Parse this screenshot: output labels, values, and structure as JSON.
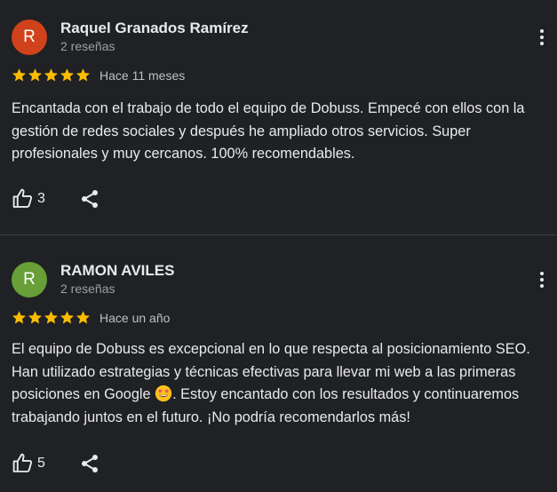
{
  "colors": {
    "background": "#202124",
    "star": "#fbbc04",
    "avatar_1": "#d0421b",
    "avatar_2": "#689f38"
  },
  "reviews": [
    {
      "avatar_letter": "R",
      "author": "Raquel Granados Ramírez",
      "review_count": "2 reseñas",
      "stars": 5,
      "time": "Hace 11 meses",
      "text": "Encantada con el trabajo de todo el equipo de Dobuss. Empecé con ellos con la gestión de redes sociales y después he ampliado otros servicios. Super profesionales y muy cercanos. 100% recomendables.",
      "likes": "3",
      "icons": {
        "menu": "more-vert-icon",
        "like": "thumb-up-icon",
        "share": "share-icon"
      }
    },
    {
      "avatar_letter": "R",
      "author": "RAMON AVILES",
      "review_count": "2 reseñas",
      "stars": 5,
      "time": "Hace un año",
      "text_before_emoji": "El equipo de Dobuss es excepcional en lo que respecta al posicionamiento SEO. Han utilizado estrategias y técnicas efectivas para llevar mi web a las primeras posiciones en Google ",
      "emoji": "star-struck-emoji",
      "text_after_emoji": ". Estoy encantado con los resultados y continuaremos trabajando juntos en el futuro. ¡No podría recomendarlos más!",
      "likes": "5",
      "icons": {
        "menu": "more-vert-icon",
        "like": "thumb-up-icon",
        "share": "share-icon"
      }
    }
  ]
}
